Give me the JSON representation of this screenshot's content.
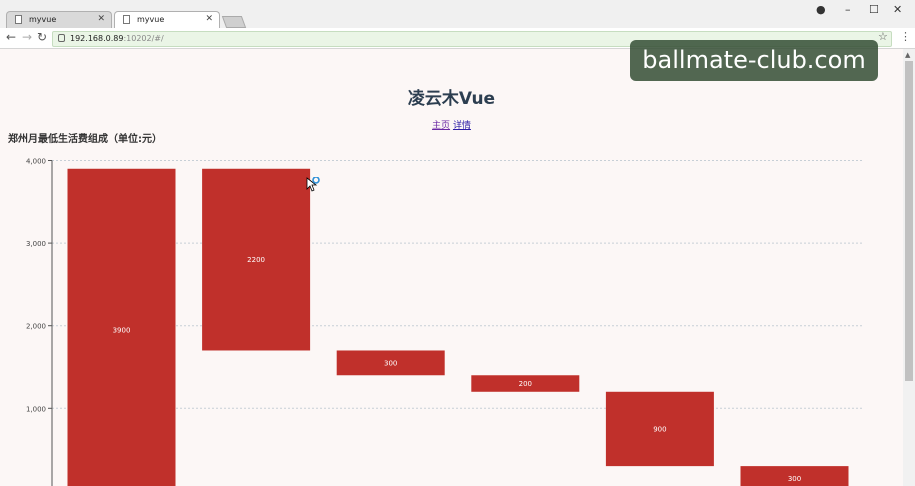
{
  "browser": {
    "tabs": [
      {
        "title": "myvue",
        "active": false
      },
      {
        "title": "myvue",
        "active": true
      }
    ],
    "url_host": "192.168.0.89",
    "url_rest": ":10202/#/"
  },
  "page": {
    "title": "凌云木Vue",
    "nav_home": "主页",
    "nav_detail": "详情",
    "chart_heading": "郑州月最低生活费组成（单位:元）"
  },
  "watermark": "ballmate-club.com",
  "colors": {
    "bar": "#c0302b",
    "grid": "#c7cfd6",
    "page_bg": "#fcf7f6"
  },
  "chart_data": {
    "type": "bar",
    "subtype": "waterfall",
    "title": "郑州月最低生活费组成（单位:元）",
    "yticks": [
      "4,000",
      "3,000",
      "2,000",
      "1,000"
    ],
    "ylim": [
      0,
      4000
    ],
    "grid": true,
    "bars": [
      {
        "base": 0,
        "value": 3900,
        "label": "3900"
      },
      {
        "base": 1700,
        "value": 2200,
        "label": "2200"
      },
      {
        "base": 1400,
        "value": 300,
        "label": "300"
      },
      {
        "base": 1200,
        "value": 200,
        "label": "200"
      },
      {
        "base": 300,
        "value": 900,
        "label": "900"
      },
      {
        "base": 0,
        "value": 300,
        "label": "300"
      }
    ]
  }
}
